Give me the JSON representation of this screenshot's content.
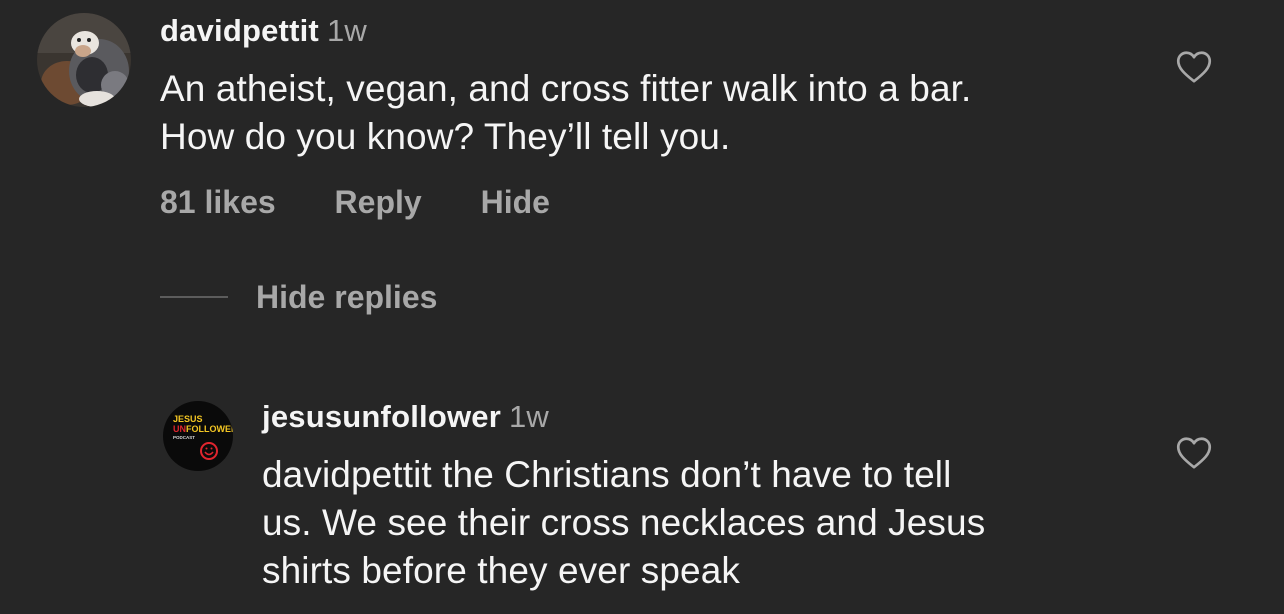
{
  "comment": {
    "username": "davidpettit",
    "time": "1w",
    "lines": [
      "An atheist, vegan, and cross fitter walk into a bar.",
      "How do you know? They’ll tell you."
    ],
    "likes": "81 likes",
    "reply": "Reply",
    "hide": "Hide",
    "avatar_icon": "dog-avatar-icon",
    "like_icon": "heart-outline-icon"
  },
  "hide_replies": "Hide replies",
  "reply": {
    "username": "jesusunfollower",
    "time": "1w",
    "lines": [
      "davidpettit the Christians don’t have to tell",
      "us. We see their cross necklaces and Jesus",
      "shirts before they ever speak"
    ],
    "avatar_logo": {
      "line1": "JESUS",
      "line2_accent": "UN",
      "line2_rest": "FOLLOWER",
      "line3": "PODCAST"
    },
    "like_icon": "heart-outline-icon"
  },
  "colors": {
    "background": "#262626",
    "primary_text": "#f5f5f5",
    "secondary_text": "#a8a8a8",
    "logo_red": "#e0252e",
    "logo_gold": "#f3c623"
  }
}
